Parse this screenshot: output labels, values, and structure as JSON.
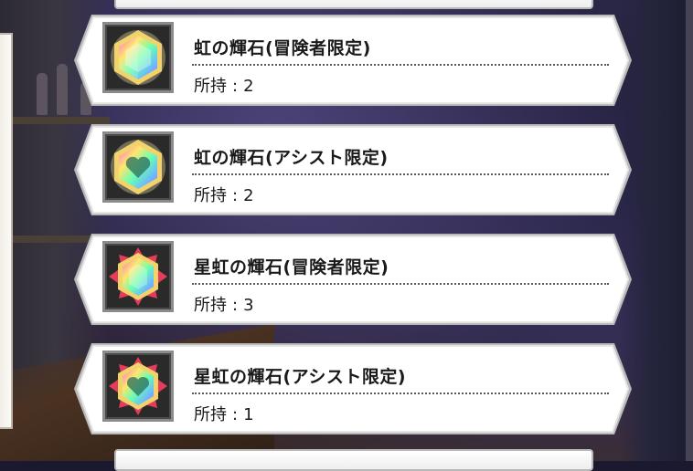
{
  "items": [
    {
      "name": "虹の輝石(冒険者限定)",
      "owned_label": "所持",
      "owned_sep": ":",
      "count": "2",
      "icon": "hexagon-rainbow-gem-icon"
    },
    {
      "name": "虹の輝石(アシスト限定)",
      "owned_label": "所持",
      "owned_sep": ":",
      "count": "2",
      "icon": "hexagon-rainbow-heart-gem-icon"
    },
    {
      "name": "星虹の輝石(冒険者限定)",
      "owned_label": "所持",
      "owned_sep": ":",
      "count": "3",
      "icon": "star-rainbow-gem-icon"
    },
    {
      "name": "星虹の輝石(アシスト限定)",
      "owned_label": "所持",
      "owned_sep": ":",
      "count": "1",
      "icon": "star-rainbow-heart-gem-icon"
    }
  ],
  "colors": {
    "card_fill": "#ffffff",
    "card_border": "#b9b9b9",
    "text": "#1a1a1a",
    "gem_border_gold": "#f2d36b"
  }
}
